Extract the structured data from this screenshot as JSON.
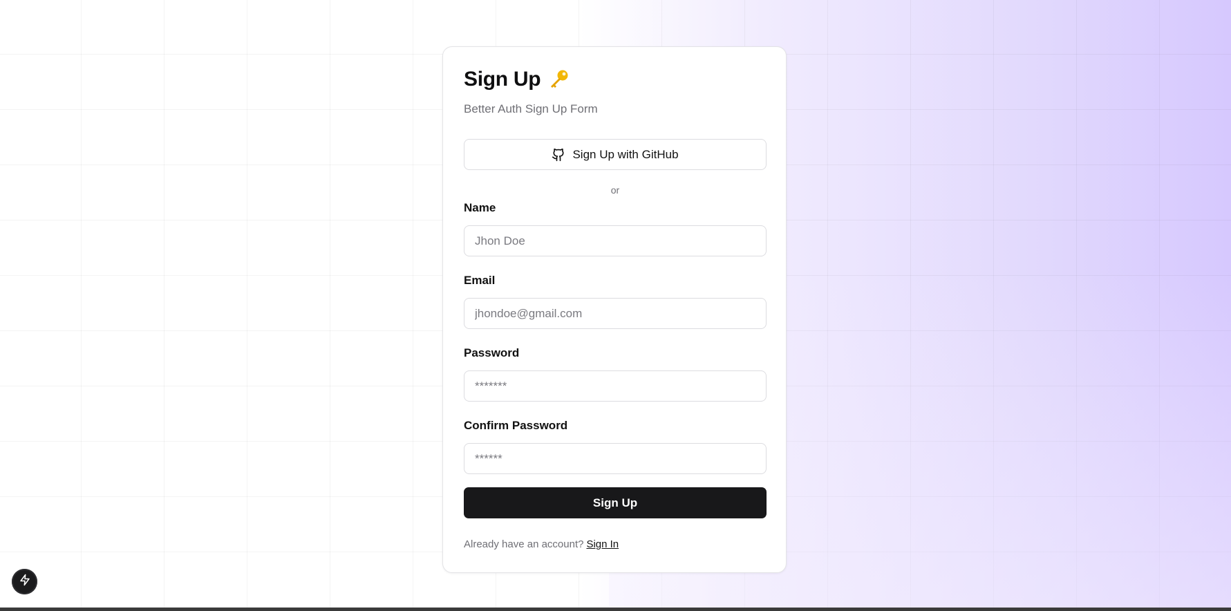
{
  "card": {
    "title": "Sign Up",
    "title_icon": "key-icon",
    "subtitle": "Better Auth Sign Up Form"
  },
  "github_button": {
    "label": "Sign Up with GitHub",
    "icon": "github-icon"
  },
  "divider_text": "or",
  "fields": {
    "name": {
      "label": "Name",
      "placeholder": "Jhon Doe",
      "value": ""
    },
    "email": {
      "label": "Email",
      "placeholder": "jhondoe@gmail.com",
      "value": ""
    },
    "password": {
      "label": "Password",
      "placeholder": "*******",
      "value": ""
    },
    "confirm_password": {
      "label": "Confirm Password",
      "placeholder": "******",
      "value": ""
    }
  },
  "submit_button": {
    "label": "Sign Up"
  },
  "footer": {
    "prompt": "Already have an account?",
    "link": "Sign In"
  },
  "fab": {
    "icon": "lightning-icon"
  },
  "colors": {
    "primary_button": "#18181a",
    "background_accent": "#d6c8fe",
    "key_icon": "#f2b705"
  }
}
